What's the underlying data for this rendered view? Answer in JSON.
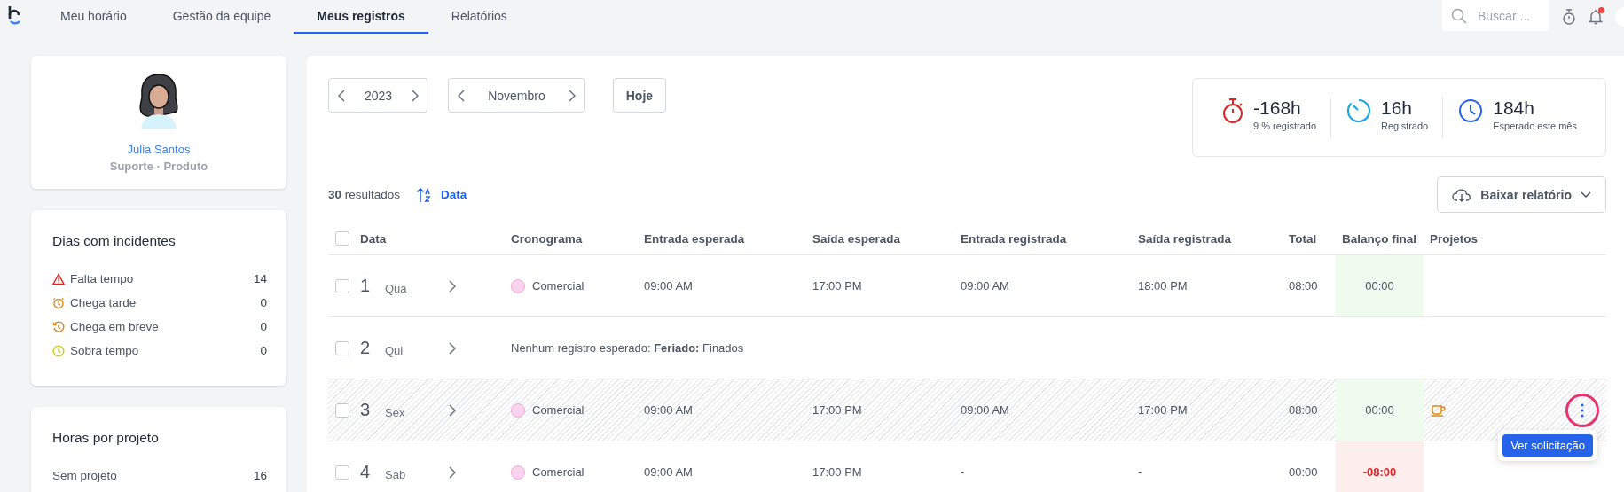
{
  "nav": {
    "tabs": [
      {
        "label": "Meu horário",
        "selected": false
      },
      {
        "label": "Gestão da equipe",
        "selected": false
      },
      {
        "label": "Meus registros",
        "selected": true
      },
      {
        "label": "Relatórios",
        "selected": false
      }
    ],
    "search": {
      "placeholder": "Buscar ..."
    },
    "has_notification": true
  },
  "profile": {
    "name": "Julia Santos",
    "team": "Suporte · Produto"
  },
  "incidents": {
    "title": "Dias com incidentes",
    "items": [
      {
        "kind": "missing",
        "label": "Falta tempo",
        "count": "14"
      },
      {
        "kind": "late",
        "label": "Chega tarde",
        "count": "0"
      },
      {
        "kind": "early",
        "label": "Chega em breve",
        "count": "0"
      },
      {
        "kind": "extra",
        "label": "Sobra tempo",
        "count": "0"
      }
    ]
  },
  "projects": {
    "title": "Horas por projeto",
    "items": [
      {
        "label": "Sem projeto",
        "hours": "16"
      }
    ]
  },
  "period": {
    "year": "2023",
    "month": "Novembro",
    "today": "Hoje"
  },
  "summary": [
    {
      "kind": "deficit",
      "value": "-168h",
      "label": "9 % registrado"
    },
    {
      "kind": "registered",
      "value": "16h",
      "label": "Registrado"
    },
    {
      "kind": "expected",
      "value": "184h",
      "label": "Esperado este mês"
    }
  ],
  "results": {
    "count": "30",
    "label": "resultados",
    "sort": "Data"
  },
  "download": "Baixar relatório",
  "table": {
    "columns": [
      "Data",
      "Cronograma",
      "Entrada esperada",
      "Saída esperada",
      "Entrada registrada",
      "Saída registrada",
      "Total",
      "Balanço final",
      "Projetos"
    ],
    "select_all_checked": false,
    "rows": [
      {
        "kind": "schedule",
        "checked": false,
        "pending": false,
        "day": "1",
        "weekday": "Qua",
        "schedule": "Comercial",
        "color": "#fbd3ee",
        "exp_in": "09:00 AM",
        "exp_out": "17:00 PM",
        "reg_in": "09:00 AM",
        "reg_out": "18:00 PM",
        "total": "08:00",
        "balance": "00:00",
        "negative": false,
        "has_break": false
      },
      {
        "kind": "holiday",
        "checked": false,
        "pending": false,
        "day": "2",
        "weekday": "Qui",
        "note": "Nenhum registro esperado: **Feriado:** Finados"
      },
      {
        "kind": "schedule",
        "checked": false,
        "pending": true,
        "day": "3",
        "weekday": "Sex",
        "schedule": "Comercial",
        "color": "#fbd3ee",
        "exp_in": "09:00 AM",
        "exp_out": "17:00 PM",
        "reg_in": "09:00 AM",
        "reg_out": "17:00 PM",
        "total": "08:00",
        "balance": "00:00",
        "negative": false,
        "has_break": true,
        "menu": {
          "highlighted": true,
          "tooltip": "Ver solicitação"
        }
      },
      {
        "kind": "schedule",
        "checked": false,
        "pending": false,
        "day": "4",
        "weekday": "Sab",
        "schedule": "Comercial",
        "color": "#fbd3ee",
        "exp_in": "09:00 AM",
        "exp_out": "17:00 PM",
        "reg_in": "-",
        "reg_out": "-",
        "total": "00:00",
        "balance": "-08:00",
        "negative": true,
        "has_break": false
      }
    ]
  }
}
